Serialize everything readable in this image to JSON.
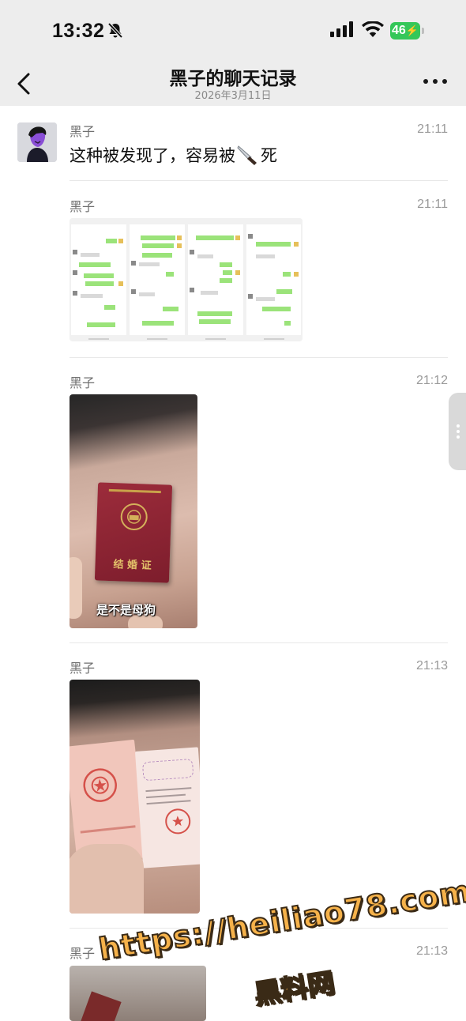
{
  "status_bar": {
    "time": "13:32",
    "battery": "46"
  },
  "header": {
    "title": "黑子的聊天记录",
    "subtitle": "2026年3月11日"
  },
  "messages": [
    {
      "sender": "黑子",
      "time": "21:11",
      "text_before": "这种被发现了，容易被",
      "text_after": "死"
    },
    {
      "sender": "黑子",
      "time": "21:11"
    },
    {
      "sender": "黑子",
      "time": "21:12",
      "image_caption": "是不是母狗",
      "booklet_title": "结 婚 证"
    },
    {
      "sender": "黑子",
      "time": "21:13"
    },
    {
      "sender": "黑子",
      "time": "21:13"
    }
  ],
  "watermark": {
    "url": "https://heiliao78.com",
    "name": "黑料网"
  },
  "colors": {
    "status_bg": "#ededed",
    "battery": "#34c759",
    "watermark_fill": "#f6b24a",
    "watermark_stroke": "#3a2a16"
  }
}
